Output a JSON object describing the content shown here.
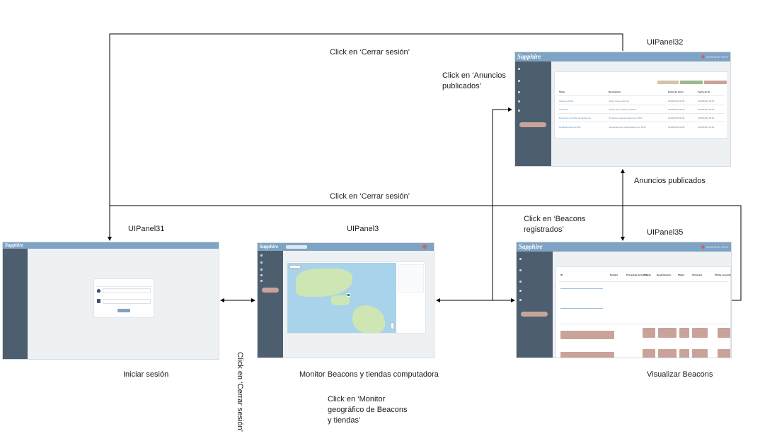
{
  "colors": {
    "topbar": "#7ea3c4",
    "sidebar": "#4d5f6f",
    "content_bg": "#eef1f4",
    "accent_button": "#c9a39a",
    "link": "#4b86c2",
    "flow_line": "#000000"
  },
  "flow_labels": {
    "logout_top": "Click en ‘Cerrar sesión’",
    "logout_middle": "Click en ‘Cerrar sesión’",
    "to_ads": "Click en ‘Anuncios\npublicados’",
    "to_beacons": "Click en ‘Beacons\nregistrados’",
    "logout_vertical": "Click en ‘Cerrar sesión’",
    "to_monitor": "Click en ‘Monitor\ngeográfico de Beacons\ny tiendas’"
  },
  "panels": {
    "login": {
      "id": "UIPanel31",
      "caption": "Iniciar sesión",
      "brand": "Sapphire"
    },
    "monitor": {
      "id": "UIPanel3",
      "caption": "Monitor Beacons y tiendas computadora",
      "brand": "Sapphire"
    },
    "ads": {
      "id": "UIPanel32",
      "caption": "Anuncios publicados",
      "brand": "Sapphire",
      "user": "Gabriela Zamite Herrera",
      "table": {
        "headers": [
          "Título",
          "Descripción",
          "Fecha de inicio",
          "Fecha de fin"
        ],
        "rows": [
          {
            "title": "Venta nocturna",
            "desc": "¡Gran venta nocturna!",
            "start": "2018/04/09 00:00",
            "end": "2018/04/09 00:00"
          },
          {
            "title": "Venta 3x1",
            "desc": "¡Todos los productos al 30%!",
            "start": "2018/04/09 00:00",
            "end": "2018/04/09 00:00"
          },
          {
            "title": "Productos con 20% de descuento",
            "desc": "¡Productos seleccionados con 20%!",
            "start": "2018/04/09 00:00",
            "end": "2018/04/09 00:00"
          },
          {
            "title": "Departamentos al 30%",
            "desc": "¡Departamentos participantes con 30%!",
            "start": "2018/04/09 00:00",
            "end": "2018/04/09 00:00"
          }
        ]
      }
    },
    "beacons": {
      "id": "UIPanel35",
      "caption": "Visualizar Beacons",
      "brand": "Sapphire",
      "user": "Gabriela Zamite Herrera",
      "table": {
        "headers": [
          "ID",
          "Nombre",
          "Porcentaje de batería",
          "Tienda",
          "Departamento",
          "Planta",
          "Ubicación",
          "Última conexión"
        ]
      }
    }
  }
}
